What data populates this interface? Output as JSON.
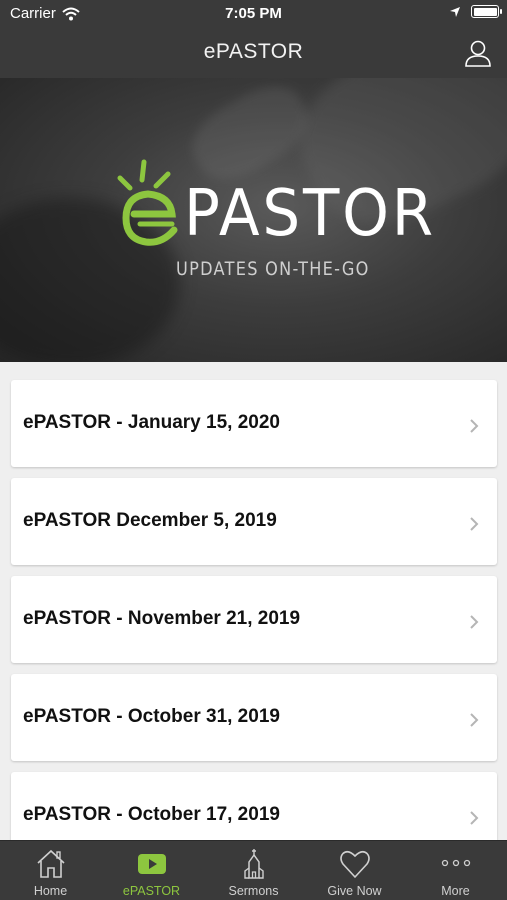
{
  "status_bar": {
    "carrier": "Carrier",
    "time": "7:05 PM",
    "battery_level": 1.0,
    "icons": [
      "wifi-icon",
      "location-arrow-icon",
      "battery-icon"
    ]
  },
  "nav": {
    "title": "ePASTOR",
    "right_icon": "person-icon"
  },
  "hero": {
    "logo_text": "PASTOR",
    "logo_prefix": "e",
    "tagline": "UPDATES ON-THE-GO",
    "accent_color": "#8dc63f"
  },
  "list": {
    "items": [
      {
        "label": "ePASTOR - January 15, 2020"
      },
      {
        "label": "ePASTOR December 5, 2019"
      },
      {
        "label": "ePASTOR - November 21, 2019"
      },
      {
        "label": "ePASTOR - October 31, 2019"
      },
      {
        "label": "ePASTOR - October 17, 2019"
      }
    ]
  },
  "tabs": [
    {
      "label": "Home",
      "icon": "home-icon",
      "active": false
    },
    {
      "label": "ePASTOR",
      "icon": "play-icon",
      "active": true
    },
    {
      "label": "Sermons",
      "icon": "church-icon",
      "active": false
    },
    {
      "label": "Give Now",
      "icon": "heart-icon",
      "active": false
    },
    {
      "label": "More",
      "icon": "more-dots-icon",
      "active": false
    }
  ],
  "colors": {
    "bar_background": "#3a3a3a",
    "active_tab": "#8dc63f",
    "list_background": "#efefef"
  }
}
